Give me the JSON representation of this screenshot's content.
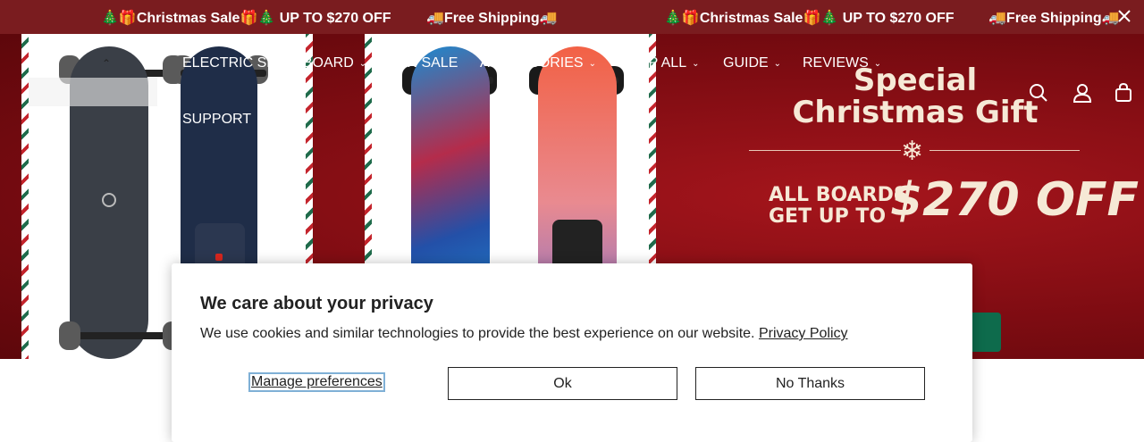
{
  "announcement": {
    "messages": [
      "🎄🎁Christmas Sale🎁🎄 UP TO $270 OFF",
      "🚚Free Shipping🚚",
      "🎄🎁Christmas Sale🎁🎄 UP TO $270 OFF",
      "🚚Free Shipping🚚"
    ],
    "close_icon": "close-icon"
  },
  "nav": {
    "items": [
      {
        "label": "ELECTRIC SKATEBOARD",
        "has_dropdown": true
      },
      {
        "label": "ON SALE",
        "has_dropdown": false
      },
      {
        "label": "ACCESSORIES",
        "has_dropdown": true
      },
      {
        "label": "SHOP ALL",
        "has_dropdown": true
      },
      {
        "label": "GUIDE",
        "has_dropdown": true
      },
      {
        "label": "REVIEWS",
        "has_dropdown": true
      },
      {
        "label": "SUPPORT",
        "has_dropdown": false
      }
    ],
    "icons": [
      "search-icon",
      "account-icon",
      "cart-icon"
    ]
  },
  "hero": {
    "headline_line1": "Special",
    "headline_line2": "Christmas Gift",
    "offer_line1": "ALL BOARDS",
    "offer_line2": "GET UP TO",
    "offer_amount": "$270 OFF",
    "colors": {
      "background": "#8b0f15",
      "text": "#f6e9d6",
      "button": "#0e6b4c"
    }
  },
  "cookie": {
    "title": "We care about your privacy",
    "body": "We use cookies and similar technologies to provide the best experience on our website.",
    "policy_link": "Privacy Policy",
    "manage_label": "Manage preferences",
    "ok_label": "Ok",
    "no_label": "No Thanks"
  }
}
